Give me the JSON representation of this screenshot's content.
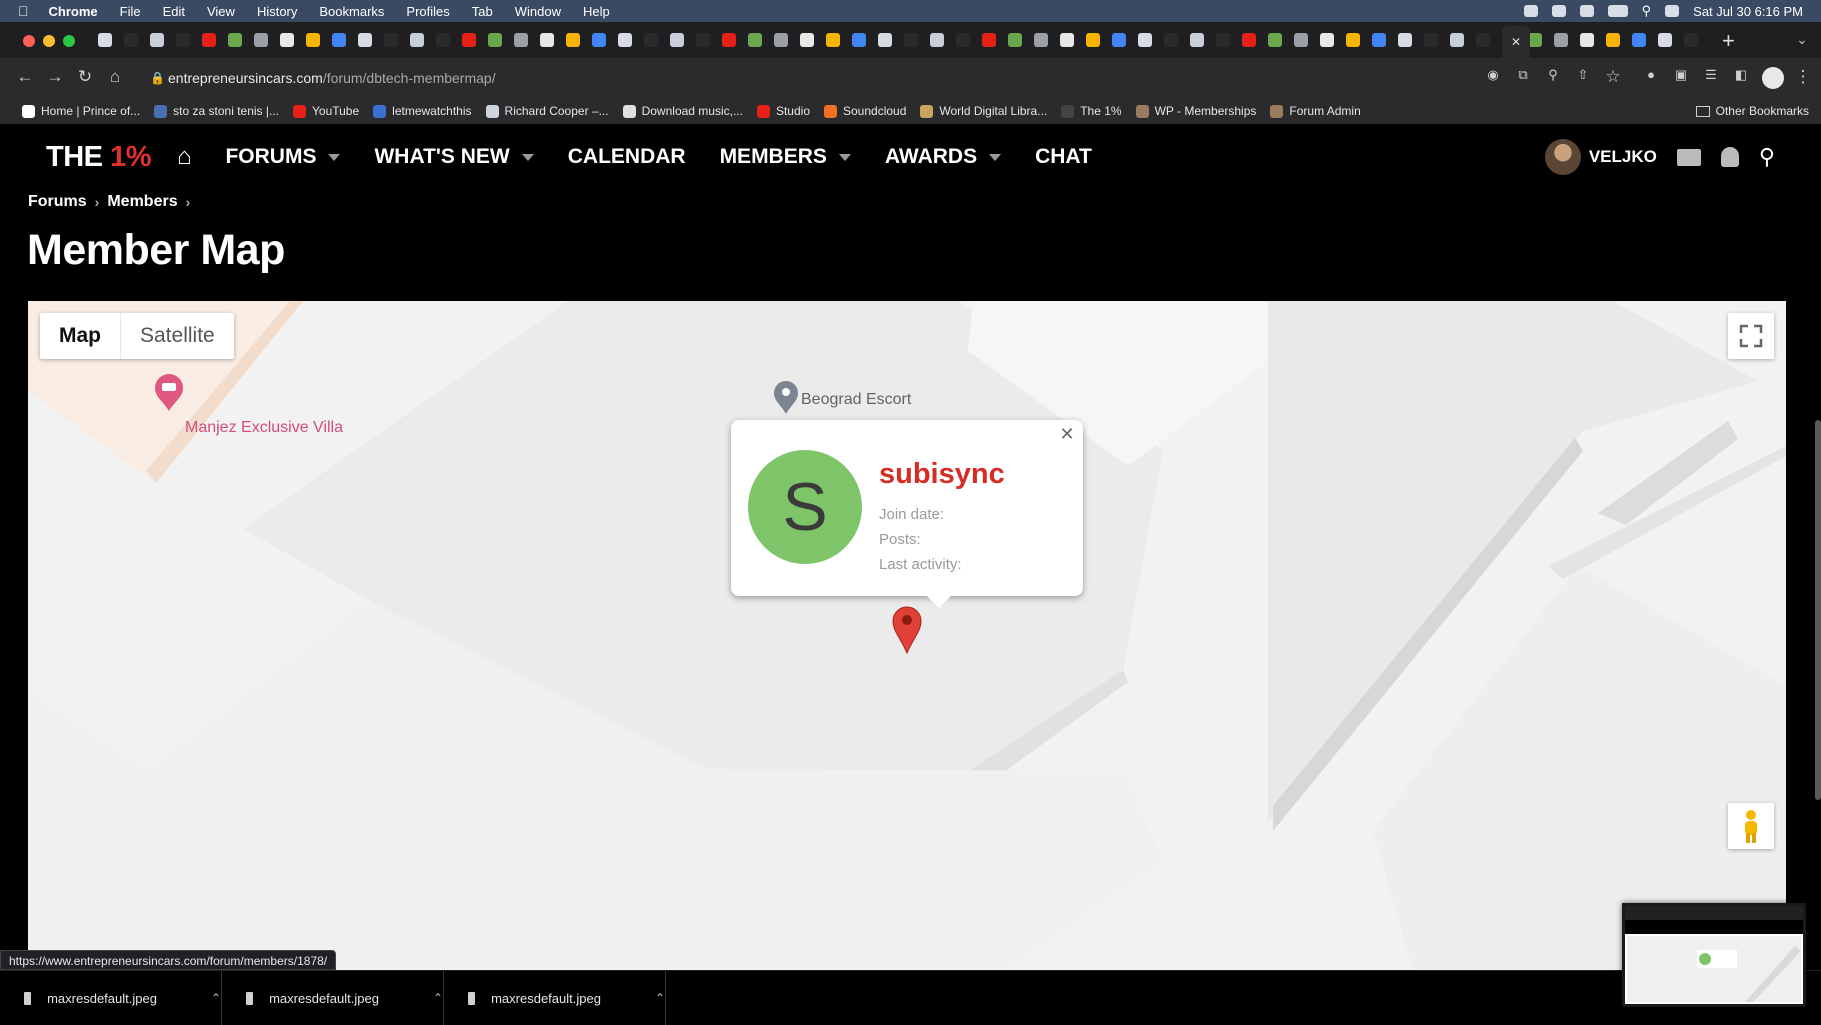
{
  "menubar": {
    "app": "Chrome",
    "items": [
      "File",
      "Edit",
      "View",
      "History",
      "Bookmarks",
      "Profiles",
      "Tab",
      "Window",
      "Help"
    ],
    "clock": "Sat Jul 30  6:16 PM"
  },
  "address": {
    "domain": "entrepreneursincars.com",
    "path": "/forum/dbtech-membermap/"
  },
  "bookmarks": {
    "items": [
      {
        "label": "Home | Prince of...",
        "color": "#ffffff"
      },
      {
        "label": "sto za stoni tenis |...",
        "color": "#4a6fb3"
      },
      {
        "label": "YouTube",
        "color": "#e62117"
      },
      {
        "label": "letmewatchthis",
        "color": "#3b6fd6"
      },
      {
        "label": "Richard Cooper –...",
        "color": "#cfd5df"
      },
      {
        "label": "Download music,...",
        "color": "#e0e0e0"
      },
      {
        "label": "Studio",
        "color": "#e62117"
      },
      {
        "label": "Soundcloud",
        "color": "#f26f23"
      },
      {
        "label": "World Digital Libra...",
        "color": "#c9a55e"
      },
      {
        "label": "The 1%",
        "color": "#444444"
      },
      {
        "label": "WP - Memberships",
        "color": "#9a7b5d"
      },
      {
        "label": "Forum Admin",
        "color": "#9a7b5d"
      }
    ],
    "other": "Other Bookmarks"
  },
  "site": {
    "logo_main": "THE ",
    "logo_accent": "1%",
    "nav": {
      "forums": "FORUMS",
      "whats_new": "WHAT'S NEW",
      "calendar": "CALENDAR",
      "members": "MEMBERS",
      "awards": "AWARDS",
      "chat": "CHAT"
    },
    "username": "VELJKO",
    "accent_color": "#e0322d"
  },
  "breadcrumb": {
    "forums": "Forums",
    "members": "Members"
  },
  "page_title": "Member Map",
  "map": {
    "type_map": "Map",
    "type_satellite": "Satellite",
    "poi_villa": "Manjez Exclusive Villa",
    "poi_escort": "Beograd Escort",
    "info": {
      "avatar_letter": "S",
      "username": "subisync",
      "join_date_label": "Join date:",
      "posts_label": "Posts:",
      "last_activity_label": "Last activity:"
    }
  },
  "status_url": "https://www.entrepreneursincars.com/forum/members/1878/",
  "downloads": [
    "maxresdefault.jpeg",
    "maxresdefault.jpeg",
    "maxresdefault.jpeg"
  ]
}
